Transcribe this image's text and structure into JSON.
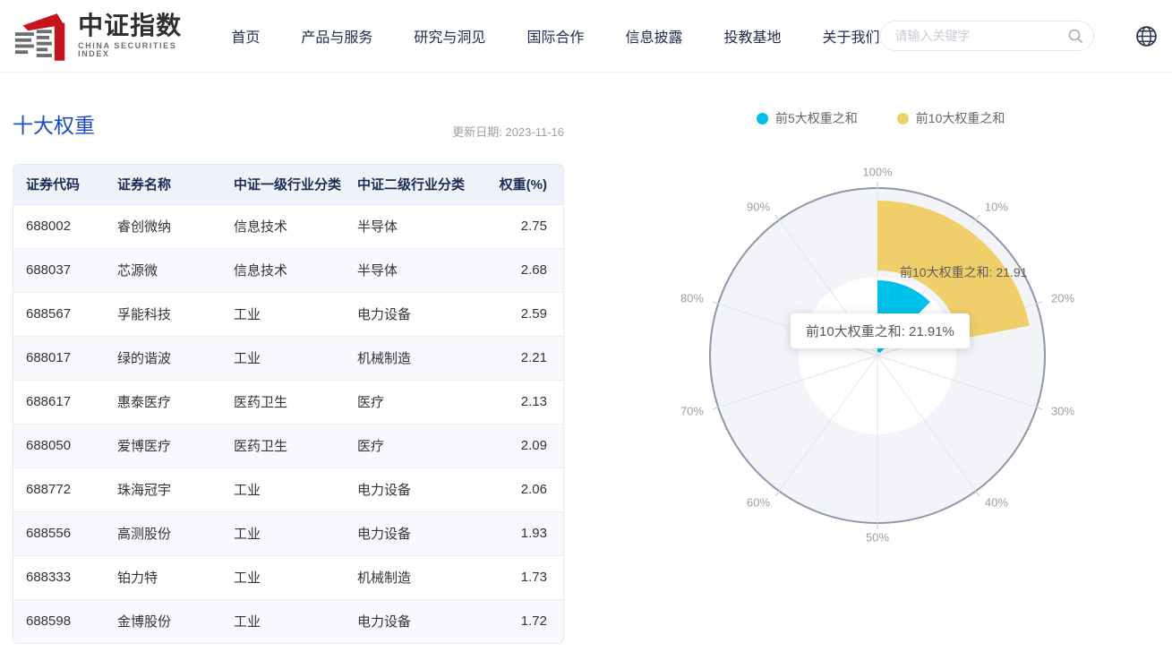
{
  "header": {
    "logo_title": "中证指数",
    "logo_subtitle": "CHINA SECURITIES INDEX",
    "nav": [
      "首页",
      "产品与服务",
      "研究与洞见",
      "国际合作",
      "信息披露",
      "投教基地",
      "关于我们"
    ],
    "search_placeholder": "请输入关键字"
  },
  "page": {
    "title": "十大权重",
    "update_date": "更新日期: 2023-11-16"
  },
  "table": {
    "columns": [
      "证券代码",
      "证券名称",
      "中证一级行业分类",
      "中证二级行业分类",
      "权重(%)"
    ],
    "rows": [
      [
        "688002",
        "睿创微纳",
        "信息技术",
        "半导体",
        "2.75"
      ],
      [
        "688037",
        "芯源微",
        "信息技术",
        "半导体",
        "2.68"
      ],
      [
        "688567",
        "孚能科技",
        "工业",
        "电力设备",
        "2.59"
      ],
      [
        "688017",
        "绿的谐波",
        "工业",
        "机械制造",
        "2.21"
      ],
      [
        "688617",
        "惠泰医疗",
        "医药卫生",
        "医疗",
        "2.13"
      ],
      [
        "688050",
        "爱博医疗",
        "医药卫生",
        "医疗",
        "2.09"
      ],
      [
        "688772",
        "珠海冠宇",
        "工业",
        "电力设备",
        "2.06"
      ],
      [
        "688556",
        "高测股份",
        "工业",
        "电力设备",
        "1.93"
      ],
      [
        "688333",
        "铂力特",
        "工业",
        "机械制造",
        "1.73"
      ],
      [
        "688598",
        "金博股份",
        "工业",
        "电力设备",
        "1.72"
      ]
    ]
  },
  "chart_data": {
    "type": "bar",
    "layout": "polar",
    "angle_range": [
      0,
      100
    ],
    "angle_unit": "%",
    "angle_tick_labels": [
      "100%",
      "10%",
      "20%",
      "30%",
      "40%",
      "50%",
      "60%",
      "70%",
      "80%",
      "90%"
    ],
    "series": [
      {
        "name": "前5大权重之和",
        "value": 12.36,
        "color": "#00c1ea"
      },
      {
        "name": "前10大权重之和",
        "value": 21.91,
        "color": "#f0cf6a"
      }
    ],
    "bar_label": "前10大权重之和: 21.91",
    "tooltip_text": "前10大权重之和: 21.91%",
    "legend_position": "top-right",
    "grid": "polar spokes every 10%",
    "colors": {
      "plot_bg": "#f3f4f8",
      "inner_circle": "#ffffff",
      "axis_circle": "#8f95ab",
      "spoke": "#e3e6ee",
      "tick": "#c4c8d4",
      "tick_label": "#9b9ea8"
    }
  }
}
